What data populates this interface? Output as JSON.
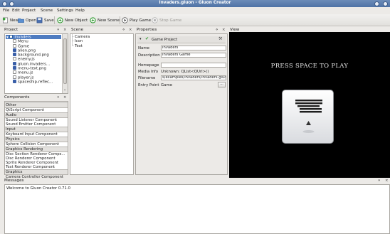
{
  "window": {
    "title": "Invaders.gluon - Gluon Creator"
  },
  "menu": [
    "File",
    "Edit",
    "Project",
    "Scene",
    "Settings",
    "Help"
  ],
  "toolbar": {
    "new": "New",
    "open": "Open",
    "save": "Save",
    "new_object": "New Object",
    "new_scene": "New Scene",
    "play_game": "Play Game",
    "stop_game": "Stop Game"
  },
  "project": {
    "title": "Project",
    "items": [
      "Invaders",
      "Menu",
      "Game",
      "alien.png",
      "background.png",
      "enemy.js",
      "gluon.invaders...",
      "menu-text.png",
      "menu.js",
      "player.js",
      "spaceship-reflec..."
    ]
  },
  "scene": {
    "title": "Scene",
    "items": [
      "Camera",
      "Icon",
      "Text"
    ]
  },
  "properties": {
    "title": "Properties",
    "header": "Game Project",
    "rows": [
      {
        "label": "Name",
        "value": "Invaders"
      },
      {
        "label": "Description",
        "value": "Invaders Game"
      },
      {
        "label": "Homepage",
        "value": ""
      },
      {
        "label": "Media Info",
        "value": "Unknown: QList<QUrl>()"
      },
      {
        "label": "Filename",
        "value": "s/examples/invaders/invaders.gluon"
      },
      {
        "label": "Entry Point",
        "value": "Game"
      }
    ],
    "browse": "..."
  },
  "view": {
    "title": "View",
    "game_text": "PRESS SPACE TO PLAY"
  },
  "components": {
    "title": "Components",
    "groups": [
      {
        "name": "Other",
        "items": [
          "QtScript Component"
        ]
      },
      {
        "name": "Audio",
        "items": [
          "Sound Listener Component",
          "Sound Emitter Component"
        ]
      },
      {
        "name": "Input",
        "items": [
          "Keyboard Input Component"
        ]
      },
      {
        "name": "Physics",
        "items": [
          "Sphere Collision Component"
        ]
      },
      {
        "name": "Graphics Rendering",
        "items": [
          "Disc Section Renderer Comps...",
          "Disc Renderer Component",
          "Sprite Renderer Component",
          "Text Renderer Component"
        ]
      },
      {
        "name": "Graphics",
        "items": [
          "Camera Controller Component"
        ]
      }
    ]
  },
  "messages": {
    "title": "Messages",
    "lines": [
      "Welcome to Gluon Creator 0.71.0"
    ]
  },
  "dock_controls": {
    "float": "⋄",
    "close": "×"
  },
  "colors": {
    "selection": "#4f7cc1",
    "titlebar": "#5b7db0",
    "play_green": "#2f9a2f"
  }
}
